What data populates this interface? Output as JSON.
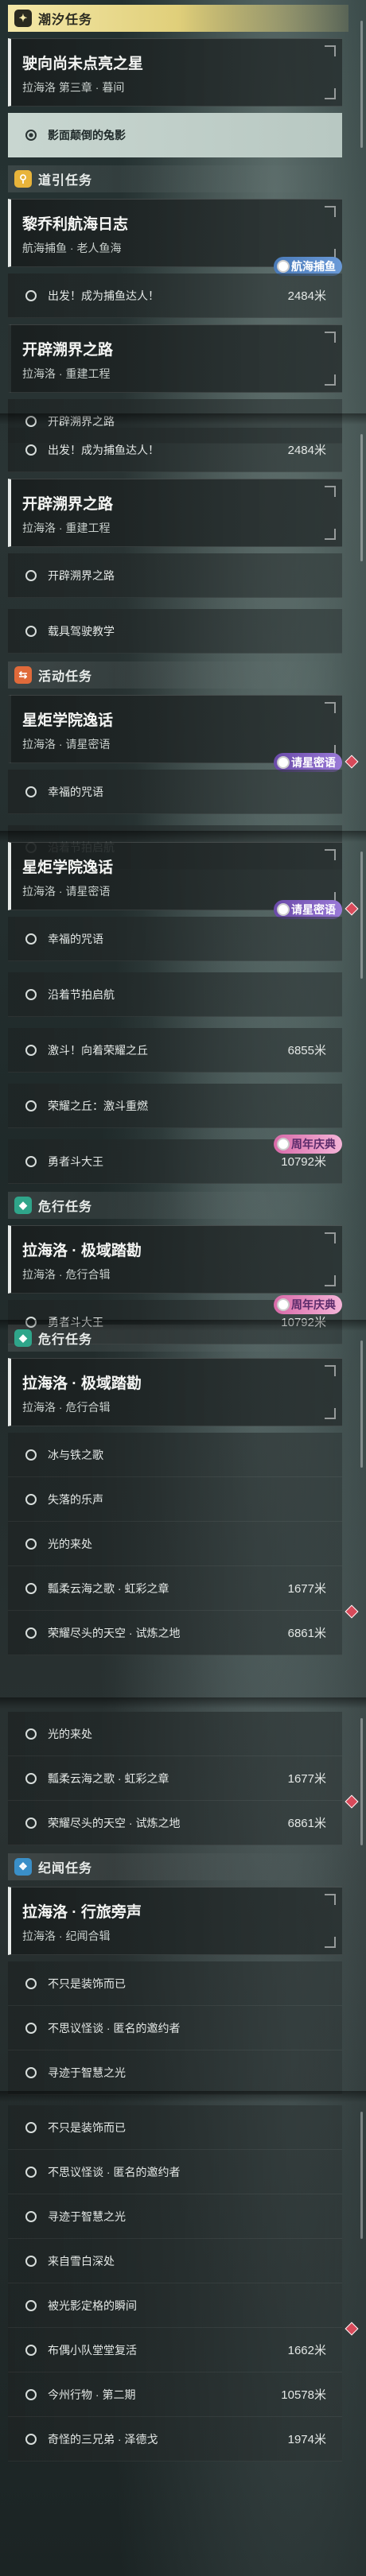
{
  "panels": [
    {
      "sections": [
        {
          "title": "潮汐任务",
          "icon": "star-icon",
          "glyph": "✦",
          "style": "yellow",
          "cards": [
            {
              "title": "驶向尚未点亮之星",
              "sub": "拉海洛 第三章 · 暮间",
              "active": true,
              "items": [
                {
                  "label": "影面颠倒的兔影",
                  "selected": true
                }
              ]
            }
          ]
        },
        {
          "title": "道引任务",
          "icon": "location-pin-icon",
          "glyph": "⚲",
          "style": "gold",
          "cards": [
            {
              "title": "黎乔利航海日志",
              "sub": "航海捕鱼 · 老人鱼海",
              "active": true,
              "badge": "航海捕鱼",
              "badgeStyle": "blue",
              "items": [
                {
                  "label": "出发！成为捕鱼达人！",
                  "dist": "2484米"
                }
              ]
            },
            {
              "title": "开辟溯界之路",
              "sub": "拉海洛 · 重建工程",
              "items": [
                {
                  "label": "开辟溯界之路"
                }
              ]
            }
          ]
        }
      ]
    },
    {
      "sections": [
        {
          "title": "",
          "cards": [
            {
              "title": "",
              "sub": "",
              "headless": true,
              "items": [
                {
                  "label": "出发！成为捕鱼达人！",
                  "dist": "2484米"
                }
              ]
            },
            {
              "title": "开辟溯界之路",
              "sub": "拉海洛 · 重建工程",
              "active": true,
              "items": [
                {
                  "label": "开辟溯界之路"
                },
                {
                  "label": "载具驾驶教学",
                  "gap": true
                }
              ]
            }
          ]
        },
        {
          "title": "活动任务",
          "icon": "calendar-icon",
          "glyph": "⇆",
          "style": "orange",
          "cards": [
            {
              "title": "星炬学院逸话",
              "sub": "拉海洛 · 请星密语",
              "badge": "请星密语",
              "badgeStyle": "purple",
              "diamond": true,
              "items": [
                {
                  "label": "幸福的咒语"
                },
                {
                  "label": "沿着节拍启航",
                  "gap": true
                }
              ]
            }
          ]
        }
      ]
    },
    {
      "sections": [
        {
          "title": "",
          "cards": [
            {
              "title": "星炬学院逸话",
              "sub": "拉海洛 · 请星密语",
              "active": true,
              "badge": "请星密语",
              "badgeStyle": "purple",
              "diamond": true,
              "items": [
                {
                  "label": "幸福的咒语"
                },
                {
                  "label": "沿着节拍启航",
                  "gap": true
                },
                {
                  "label": "激斗！向着荣耀之丘",
                  "dist": "6855米",
                  "gap": true
                },
                {
                  "label": "荣耀之丘：激斗重燃",
                  "gap": true
                },
                {
                  "label": "勇者斗大王",
                  "dist": "10792米",
                  "gap": true,
                  "badge": "周年庆典",
                  "badgeStyle": "pink"
                }
              ]
            }
          ]
        },
        {
          "title": "危行任务",
          "icon": "diamond-icon",
          "glyph": "◆",
          "style": "teal",
          "cards": [
            {
              "title": "拉海洛 · 极域踏勘",
              "sub": "拉海洛 · 危行合辑",
              "active": true,
              "items": [
                {
                  "label": "勇者斗大王",
                  "dist": "10792米",
                  "badge": "周年庆典",
                  "badgeStyle": "pink"
                }
              ]
            }
          ]
        }
      ]
    },
    {
      "sections": [
        {
          "title": "危行任务",
          "icon": "diamond-icon",
          "glyph": "◆",
          "style": "teal",
          "cards": [
            {
              "title": "拉海洛 · 极域踏勘",
              "sub": "拉海洛 · 危行合辑",
              "active": true,
              "items": [
                {
                  "label": "冰与铁之歌"
                },
                {
                  "label": "失落的乐声"
                },
                {
                  "label": "光的来处"
                },
                {
                  "label": "瓢柔云海之歌 · 虹彩之章",
                  "dist": "1677米"
                },
                {
                  "label": "荣耀尽头的天空 · 试炼之地",
                  "dist": "6861米",
                  "diamond": true
                }
              ]
            }
          ]
        }
      ]
    },
    {
      "sections": [
        {
          "title": "",
          "cards": [
            {
              "title": "",
              "sub": "",
              "headless": true,
              "items": [
                {
                  "label": "光的来处"
                },
                {
                  "label": "瓢柔云海之歌 · 虹彩之章",
                  "dist": "1677米"
                },
                {
                  "label": "荣耀尽头的天空 · 试炼之地",
                  "dist": "6861米",
                  "diamond": true
                }
              ]
            }
          ]
        },
        {
          "title": "纪闻任务",
          "icon": "book-icon",
          "glyph": "❖",
          "style": "blue",
          "cards": [
            {
              "title": "拉海洛 · 行旅旁声",
              "sub": "拉海洛 · 纪闻合辑",
              "active": true,
              "items": [
                {
                  "label": "不只是装饰而已"
                },
                {
                  "label": "不思议怪谈 · 匿名的邀约者"
                },
                {
                  "label": "寻迹于智慧之光"
                }
              ]
            }
          ]
        }
      ]
    },
    {
      "sections": [
        {
          "title": "",
          "cards": [
            {
              "title": "",
              "sub": "",
              "headless": true,
              "items": [
                {
                  "label": "不只是装饰而已"
                },
                {
                  "label": "不思议怪谈 · 匿名的邀约者"
                },
                {
                  "label": "寻迹于智慧之光"
                },
                {
                  "label": "来自雪白深处"
                },
                {
                  "label": "被光影定格的瞬间"
                },
                {
                  "label": "布偶小队堂堂复活",
                  "dist": "1662米",
                  "diamond": true
                },
                {
                  "label": "今州行物 · 第二期",
                  "dist": "10578米"
                },
                {
                  "label": "奇怪的三兄弟 · 泽德戈",
                  "dist": "1974米"
                }
              ]
            }
          ]
        }
      ]
    }
  ]
}
